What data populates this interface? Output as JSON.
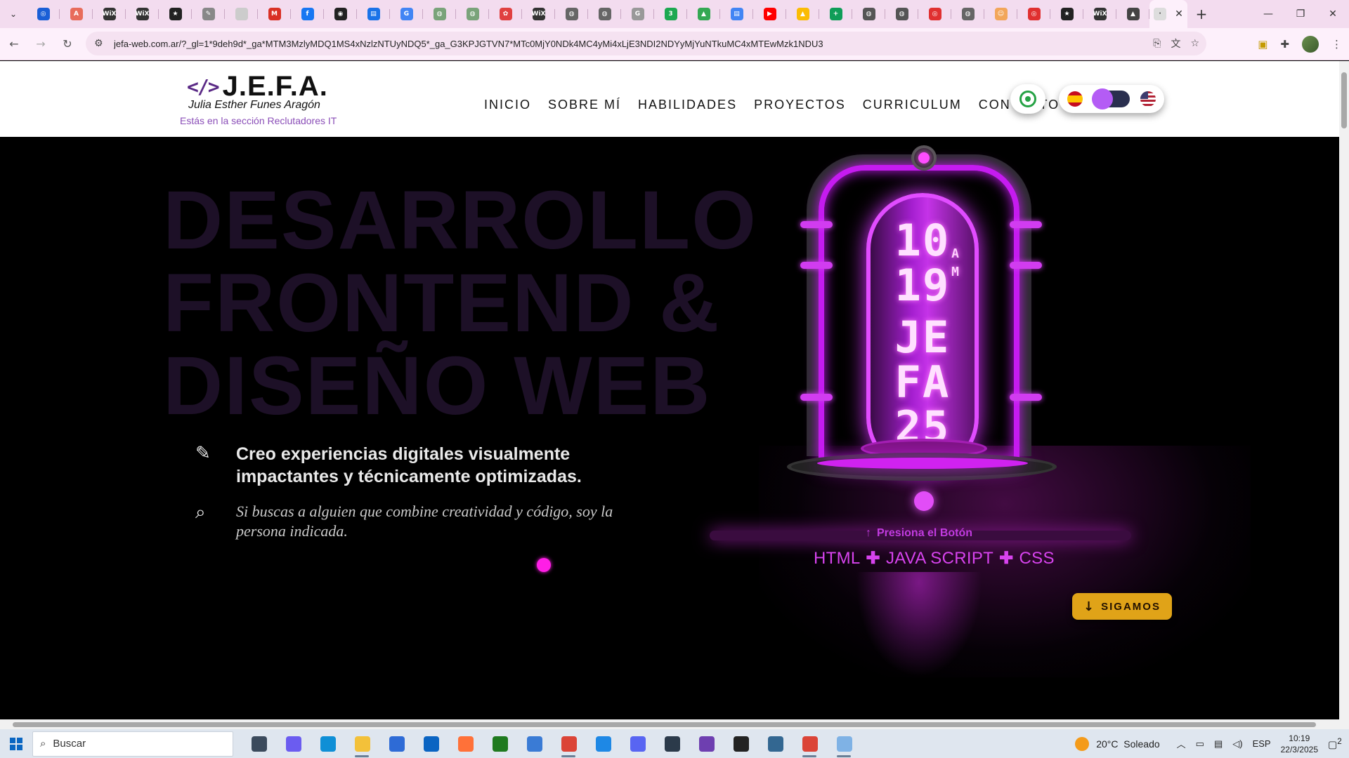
{
  "browser": {
    "tab_favicons": [
      {
        "name": "tab-1",
        "color": "#1a5fd6",
        "label": "◎"
      },
      {
        "name": "tab-2",
        "color": "#e86c5b",
        "label": "A"
      },
      {
        "name": "tab-3",
        "color": "#333333",
        "label": "WiX"
      },
      {
        "name": "tab-4",
        "color": "#333333",
        "label": "WiX"
      },
      {
        "name": "tab-5",
        "color": "#222222",
        "label": "★"
      },
      {
        "name": "tab-6",
        "color": "#888888",
        "label": "✎"
      },
      {
        "name": "tab-7",
        "color": "#cccccc",
        "label": ""
      },
      {
        "name": "tab-8",
        "color": "#d93025",
        "label": "M"
      },
      {
        "name": "tab-9",
        "color": "#1877f2",
        "label": "f"
      },
      {
        "name": "tab-10",
        "color": "#222222",
        "label": "◉"
      },
      {
        "name": "tab-11",
        "color": "#1a73e8",
        "label": "▤"
      },
      {
        "name": "tab-12",
        "color": "#4285f4",
        "label": "G"
      },
      {
        "name": "tab-13",
        "color": "#7aa37a",
        "label": "◍"
      },
      {
        "name": "tab-14",
        "color": "#7aa37a",
        "label": "◍"
      },
      {
        "name": "tab-15",
        "color": "#e04040",
        "label": "✿"
      },
      {
        "name": "tab-16",
        "color": "#333333",
        "label": "WiX"
      },
      {
        "name": "tab-17",
        "color": "#666666",
        "label": "◍"
      },
      {
        "name": "tab-18",
        "color": "#666666",
        "label": "◍"
      },
      {
        "name": "tab-19",
        "color": "#999999",
        "label": "G"
      },
      {
        "name": "tab-20",
        "color": "#1da851",
        "label": "3"
      },
      {
        "name": "tab-21",
        "color": "#34a853",
        "label": "▲"
      },
      {
        "name": "tab-22",
        "color": "#4285f4",
        "label": "▤"
      },
      {
        "name": "tab-23",
        "color": "#ff0000",
        "label": "▶"
      },
      {
        "name": "tab-24",
        "color": "#fbbc04",
        "label": "▲"
      },
      {
        "name": "tab-25",
        "color": "#0f9d58",
        "label": "+"
      },
      {
        "name": "tab-26",
        "color": "#555555",
        "label": "◍"
      },
      {
        "name": "tab-27",
        "color": "#555555",
        "label": "◍"
      },
      {
        "name": "tab-28",
        "color": "#e03030",
        "label": "◎"
      },
      {
        "name": "tab-29",
        "color": "#666666",
        "label": "◍"
      },
      {
        "name": "tab-30",
        "color": "#f2a65a",
        "label": "☺"
      },
      {
        "name": "tab-31",
        "color": "#e03030",
        "label": "◎"
      },
      {
        "name": "tab-32",
        "color": "#222222",
        "label": "★"
      },
      {
        "name": "tab-33",
        "color": "#333333",
        "label": "WiX"
      },
      {
        "name": "tab-34",
        "color": "#444444",
        "label": "▲"
      }
    ],
    "active_tab_close": "✕",
    "new_tab": "+",
    "url": "jefa-web.com.ar/?_gl=1*9deh9d*_ga*MTM3MzlyMDQ1MS4xNzlzNTUyNDQ5*_ga_G3KPJGTVN7*MTc0MjY0NDk4MC4yMi4xLjE3NDI2NDYyMjYuNTkuMC4xMTEwMzk1NDU3",
    "window_controls": {
      "minimize": "—",
      "maximize": "❐",
      "close": "✕"
    }
  },
  "site": {
    "logo": {
      "code": "</>",
      "name": "J.E.F.A.",
      "subtitle": "Julia Esther Funes Aragón"
    },
    "recruiter_note": "Estás en la sección Reclutadores IT",
    "nav": [
      "INICIO",
      "SOBRE MÍ",
      "HABILIDADES",
      "PROYECTOS",
      "CURRICULUM",
      "CONTACTO"
    ],
    "hero": {
      "headline": [
        "DESARROLLO",
        "FRONTEND &",
        "DISEÑO WEB"
      ],
      "feature_1": "Creo experiencias digitales visualmente impactantes y técnicamente optimizadas.",
      "feature_2": "Si buscas a alguien que combine creatividad y código, soy la persona indicada.",
      "clock": {
        "hour": "10",
        "minute": "19",
        "ampm_a": "A",
        "ampm_m": "M",
        "day": "JE",
        "month": "FA",
        "year": "25"
      },
      "press_hint": "Presiona el Botón",
      "stack": [
        "HTML",
        "JAVA SCRIPT",
        "CSS"
      ],
      "cta": "SIGAMOS"
    },
    "colors": {
      "accent": "#d743ee",
      "neon": "#c51bf0",
      "cta": "#e0a318",
      "headline": "#1d1027"
    }
  },
  "taskbar": {
    "search_placeholder": "Buscar",
    "apps": [
      {
        "name": "task-view-icon",
        "color": "#3b4a5c",
        "on": false
      },
      {
        "name": "copilot-icon",
        "color": "#6b5cf0",
        "on": false
      },
      {
        "name": "edge-icon",
        "color": "#0f8fd6",
        "on": false
      },
      {
        "name": "file-explorer-icon",
        "color": "#f3c13a",
        "on": true
      },
      {
        "name": "store-icon",
        "color": "#2e6bd6",
        "on": false
      },
      {
        "name": "outlook-icon",
        "color": "#0a64c2",
        "on": false
      },
      {
        "name": "firefox-icon",
        "color": "#ff7139",
        "on": false
      },
      {
        "name": "xbox-icon",
        "color": "#1f7a1f",
        "on": false
      },
      {
        "name": "notepad-icon",
        "color": "#3a7bd5",
        "on": false
      },
      {
        "name": "chrome-icon",
        "color": "#db4437",
        "on": true
      },
      {
        "name": "vscode-icon",
        "color": "#1e88e5",
        "on": false
      },
      {
        "name": "discord-icon",
        "color": "#5865f2",
        "on": false
      },
      {
        "name": "react-devtools-icon",
        "color": "#2b3a4a",
        "on": false
      },
      {
        "name": "github-icon",
        "color": "#6e3fb0",
        "on": false
      },
      {
        "name": "terminal-icon",
        "color": "#222222",
        "on": false
      },
      {
        "name": "postgres-icon",
        "color": "#336791",
        "on": false
      },
      {
        "name": "chrome-2-icon",
        "color": "#db4437",
        "on": true
      },
      {
        "name": "notepad-2-icon",
        "color": "#7fb2e5",
        "on": true
      }
    ],
    "weather": {
      "temp": "20°C",
      "condition": "Soleado"
    },
    "language": "ESP",
    "time": "10:19",
    "date": "22/3/2025",
    "notifications": "2"
  }
}
